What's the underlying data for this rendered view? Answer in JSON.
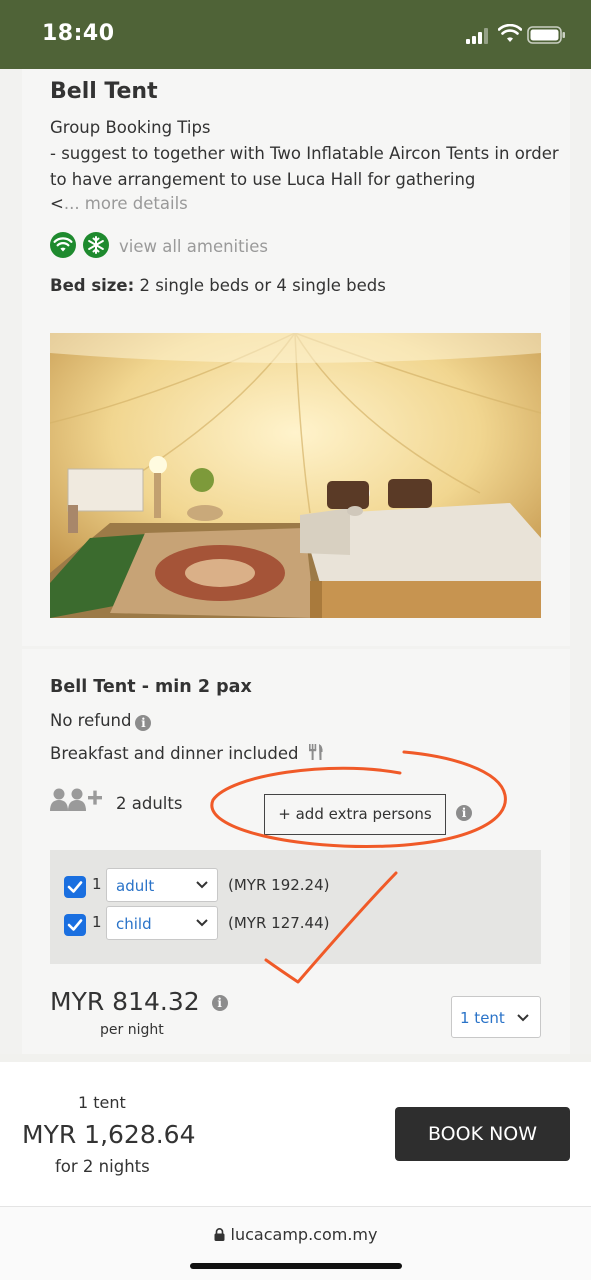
{
  "status_bar": {
    "time": "18:40"
  },
  "room": {
    "title": "Bell Tent",
    "description_lines": [
      "Group Booking Tips",
      "- suggest to together with Two Inflatable Aircon Tents in order",
      "to have arrangement to use Luca Hall for gathering"
    ],
    "more_prefix": "<",
    "more_details": "... more details",
    "amenity_icons": [
      "wifi-icon",
      "aircon-snowflake-icon"
    ],
    "view_amenities": "view all amenities",
    "bed_label": "Bed size:",
    "bed_value": " 2 single beds or 4 single beds"
  },
  "rate": {
    "title": "Bell Tent - min 2 pax",
    "refund": "No refund",
    "meals": "Breakfast and dinner included",
    "adults": "2 adults",
    "add_extra": "+  add extra persons",
    "extras": [
      {
        "checked": true,
        "qty": "1",
        "type": "adult",
        "price": "(MYR 192.24)"
      },
      {
        "checked": true,
        "qty": "1",
        "type": "child",
        "price": "(MYR 127.44)"
      }
    ],
    "price": "MYR 814.32",
    "per_night": "per night",
    "tent_select": "1 tent"
  },
  "booking_bar": {
    "tent_count": "1 tent",
    "total": "MYR 1,628.64",
    "nights": "for 2 nights",
    "book_button": "BOOK NOW"
  },
  "browser": {
    "url": "lucacamp.com.my"
  },
  "colors": {
    "status_bar": "#4f6337",
    "amenity_green": "#1e8a2e",
    "link_blue": "#2a73c8",
    "checkbox_blue": "#1a6fe0",
    "annotation_orange": "#f05a28",
    "book_button": "#2e2e2e"
  }
}
